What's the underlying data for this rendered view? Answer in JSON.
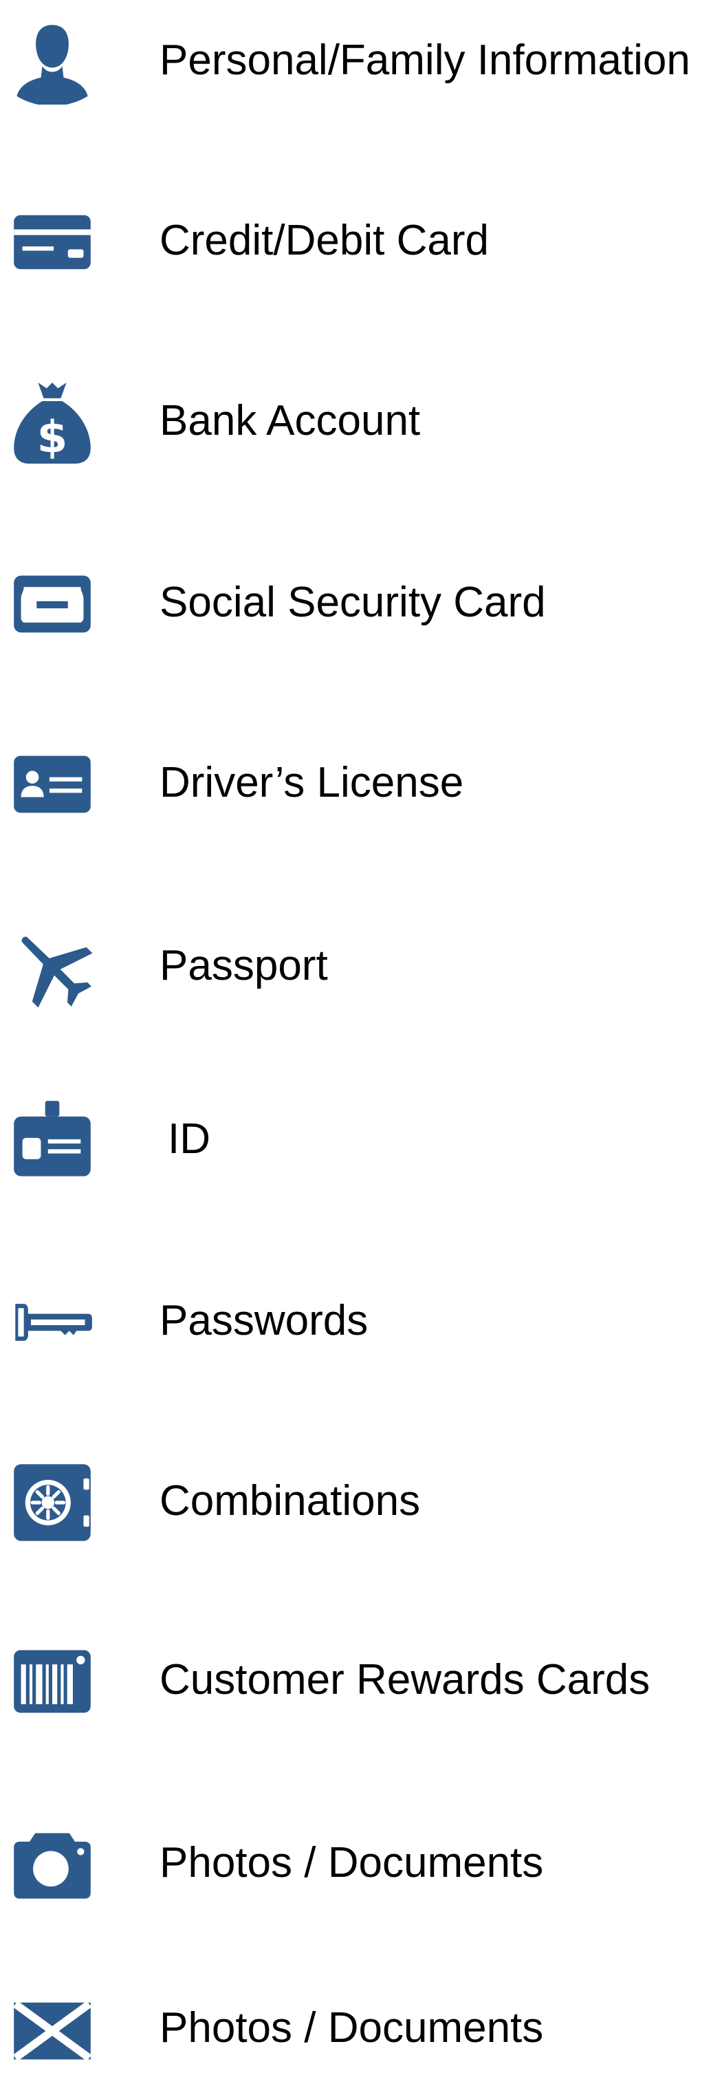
{
  "colors": {
    "icon": "#2c5a8c",
    "text": "#000000",
    "background": "#ffffff"
  },
  "items": [
    {
      "label": "Personal/Family Information",
      "icon": "person-icon"
    },
    {
      "label": "Credit/Debit Card",
      "icon": "credit-card-icon"
    },
    {
      "label": "Bank Account",
      "icon": "money-bag-icon"
    },
    {
      "label": "Social Security Card",
      "icon": "social-security-card-icon"
    },
    {
      "label": "Driver’s License",
      "icon": "drivers-license-icon"
    },
    {
      "label": "Passport",
      "icon": "airplane-icon"
    },
    {
      "label": "ID",
      "icon": "id-badge-icon"
    },
    {
      "label": "Passwords",
      "icon": "key-icon"
    },
    {
      "label": "Combinations",
      "icon": "safe-icon"
    },
    {
      "label": "Customer Rewards Cards",
      "icon": "barcode-card-icon"
    },
    {
      "label": "Photos / Documents",
      "icon": "camera-icon"
    },
    {
      "label": "Photos / Documents",
      "icon": "flag-icon"
    }
  ]
}
